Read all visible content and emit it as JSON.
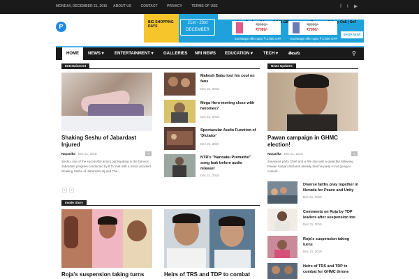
{
  "topbar": {
    "date": "MONDAY, DECEMBER 21, 2015",
    "links": [
      "ABOUT US",
      "CONTACT",
      "PRIVACY",
      "TERMS OF USE"
    ],
    "social": [
      "facebook-icon",
      "twitter-icon",
      "youtube-icon"
    ]
  },
  "header": {
    "logo_letter": "P",
    "ad": {
      "badge": "BIG SHOPPING DAYS",
      "dates": "21st - 23rd",
      "month": "DECEMBER",
      "phone1": "Asus Zenfone 2 Laser 5.5 (2 GB)",
      "phone2": "Samsung Galaxy On5 | On7",
      "price1a": "₹9999/-",
      "price1b": "₹7999/-",
      "price2a": "₹8990/-",
      "price2b": "₹7990/-",
      "exchange": "Exchange offer upto ₹ 2,900 OFF",
      "brand": "Flipkart",
      "shop": "SHOP NOW"
    }
  },
  "nav": {
    "items": [
      "HOME",
      "NEWS",
      "ENTERTAINMENT",
      "GALLERIES",
      "NRI NEWS",
      "EDUCATION",
      "TECH",
      "తెలుగు"
    ],
    "dropdown_marker": "▾"
  },
  "entertainment": {
    "section_label": "Entertainment",
    "main": {
      "title": "Shaking Seshu of Jabardast Injured",
      "author": "Nayanika",
      "date": "Dec 21, 2015",
      "comments": "0",
      "excerpt": "Seshu, one of the successful actors participating in the famous Jabardast program conducted by ETV met with a minor accident. Shaking Seshu of Jabardast Injured The..."
    },
    "side": [
      {
        "title": "Mahesh Babu lost his cool on fans",
        "date": "Dec 21, 2015"
      },
      {
        "title": "Mega Hero moving close with heroines?",
        "date": "Dec 21, 2015"
      },
      {
        "title": "Spectacular Audio Function of 'Dictator'",
        "date": "Dec 21, 2015"
      },
      {
        "title": "NTR's \"Nannaku Prematho\" song leak before audio release!",
        "date": "Dec 21, 2015"
      }
    ]
  },
  "news_updates": {
    "section_label": "News Updates",
    "main": {
      "title": "Pawan campaign in GHMC election!",
      "author": "Nayanika",
      "date": "Dec 21, 2015",
      "comments": "0",
      "excerpt": "Janasena party Chief and a film star with a great fan following Pawan Kalyan declared already that his party is not going to contest..."
    },
    "list": [
      {
        "title": "Diverse faiths pray together in Nevada for Peace and Unity",
        "date": "Dec 21, 2015"
      },
      {
        "title": "Comments on Roja by TDP leaders after suspension too",
        "date": "Dec 21, 2015"
      },
      {
        "title": "Roja's suspension taking turns",
        "date": "Dec 21, 2015"
      },
      {
        "title": "Heirs of TRS and TDP to combat for GHMC throne",
        "date": ""
      }
    ]
  },
  "inside_story": {
    "section_label": "Inside Story",
    "items": [
      {
        "title": "Roja's suspension taking turns"
      },
      {
        "title": "Heirs of TRS and TDP to combat"
      }
    ]
  },
  "pager": {
    "prev": "‹",
    "next": "›"
  },
  "colors": {
    "accent": "#4db2ec",
    "dark": "#1a1a1a",
    "ad_blue": "#1fa2dc",
    "ad_yellow": "#f6c52b"
  }
}
